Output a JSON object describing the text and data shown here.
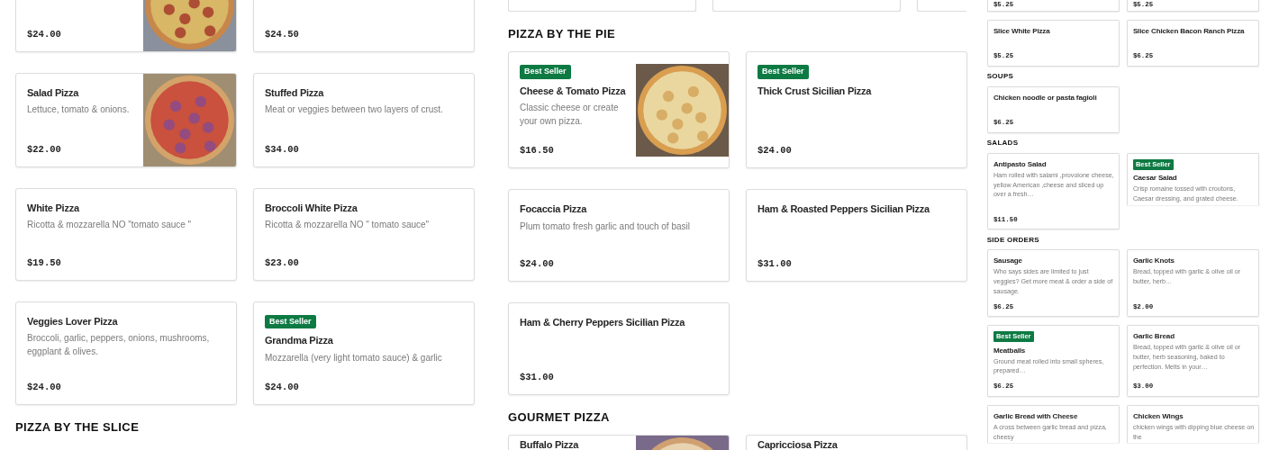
{
  "panels": [
    {
      "sections": [
        {
          "cards": [
            {
              "kind": "cut-top",
              "price": "$24.00"
            },
            {
              "kind": "cut-top",
              "price": "$24.50"
            },
            {
              "kind": "full",
              "title": "Salad Pizza",
              "description": "Lettuce, tomato & onions.",
              "price": "$22.00"
            },
            {
              "kind": "full",
              "title": "Stuffed Pizza",
              "description": "Meat or veggies between two layers of crust.",
              "price": "$34.00"
            },
            {
              "kind": "full",
              "title": "White Pizza",
              "description": "Ricotta & mozzarella NO \"tomato sauce \"",
              "price": "$19.50"
            },
            {
              "kind": "full",
              "title": "Broccoli White Pizza",
              "description": "Ricotta & mozzarella NO \" tomato sauce\"",
              "price": "$23.00"
            },
            {
              "kind": "full",
              "title": "Veggies Lover Pizza",
              "description": "Broccoli, garlic, peppers, onions, mushrooms, eggplant & olives.",
              "price": "$24.00"
            },
            {
              "kind": "full",
              "badge": "Best Seller",
              "title": "Grandma Pizza",
              "description": "Mozzarella (very light tomato sauce) & garlic",
              "price": "$24.00"
            }
          ]
        },
        {
          "heading": "PIZZA BY THE SLICE"
        }
      ]
    },
    {
      "sections": [
        {
          "carousel": [
            {
              "kind": "cut"
            },
            {
              "kind": "cut"
            },
            {
              "kind": "cut"
            }
          ]
        },
        {
          "heading": "PIZZA BY THE PIE",
          "cards": [
            {
              "kind": "full",
              "badge": "Best Seller",
              "title": "Cheese & Tomato Pizza",
              "description": "Classic cheese or create your own pizza.",
              "price": "$16.50"
            },
            {
              "kind": "full",
              "badge": "Best Seller",
              "title": "Thick Crust Sicilian Pizza",
              "price": "$24.00"
            },
            {
              "kind": "full",
              "title": "Focaccia Pizza",
              "description": "Plum tomato fresh garlic and touch of basil",
              "price": "$24.00"
            },
            {
              "kind": "full",
              "title": "Ham & Roasted Peppers Sicilian Pizza",
              "price": "$31.00"
            },
            {
              "kind": "full",
              "title": "Ham & Cherry Peppers Sicilian Pizza",
              "price": "$31.00"
            }
          ]
        },
        {
          "heading": "GOURMET PIZZA",
          "cards": [
            {
              "kind": "cut-bottom",
              "title": "Buffalo Pizza"
            },
            {
              "kind": "cut-bottom",
              "title": "Capricciosa Pizza"
            }
          ]
        }
      ]
    },
    {
      "sections": [
        {
          "cards": [
            {
              "kind": "cut-top",
              "price": "$5.25"
            },
            {
              "kind": "cut-top",
              "price": "$5.25"
            },
            {
              "kind": "full",
              "title": "Slice White Pizza",
              "price": "$5.25"
            },
            {
              "kind": "full",
              "title": "Slice Chicken Bacon Ranch Pizza",
              "price": "$6.25"
            }
          ]
        },
        {
          "heading": "SOUPS",
          "cards": [
            {
              "kind": "full",
              "title": "Chicken noodle or pasta fagioli",
              "price": "$6.25"
            }
          ]
        },
        {
          "heading": "SALADS",
          "cards": [
            {
              "kind": "tall",
              "title": "Antipasto Salad",
              "description": "Ham rolled with salami ,provolone cheese, yellow American ,cheese and sliced up over a fresh…",
              "price": "$11.50"
            },
            {
              "kind": "cut-bottom",
              "badge": "Best Seller",
              "title": "Caesar Salad",
              "description": "Crisp romaine tossed with croutons, Caesar dressing, and grated cheese."
            }
          ]
        },
        {
          "heading": "SIDE ORDERS",
          "cards": [
            {
              "kind": "full",
              "title": "Sausage",
              "description": "Who says sides are limited to just veggies? Get more meat & order a side of sausage.",
              "price": "$6.25"
            },
            {
              "kind": "full",
              "title": "Garlic Knots",
              "description": "Bread, topped with garlic & olive oil or butter, herb…",
              "price": "$2.00"
            },
            {
              "kind": "full",
              "badge": "Best Seller",
              "title": "Meatballs",
              "description": "Ground meat rolled into small spheres, prepared…",
              "price": "$6.25"
            },
            {
              "kind": "full",
              "title": "Garlic Bread",
              "description": "Bread, topped with garlic & olive oil or butter, herb seasoning, baked to perfection. Melts in your…",
              "price": "$3.00"
            },
            {
              "kind": "cut-bottom",
              "title": "Garlic Bread with Cheese",
              "description": "A cross between garlic bread and pizza, cheesy"
            },
            {
              "kind": "cut-bottom",
              "title": "Chicken Wings",
              "description": "chicken wings with dipping blue cheese on the"
            }
          ]
        }
      ]
    }
  ]
}
